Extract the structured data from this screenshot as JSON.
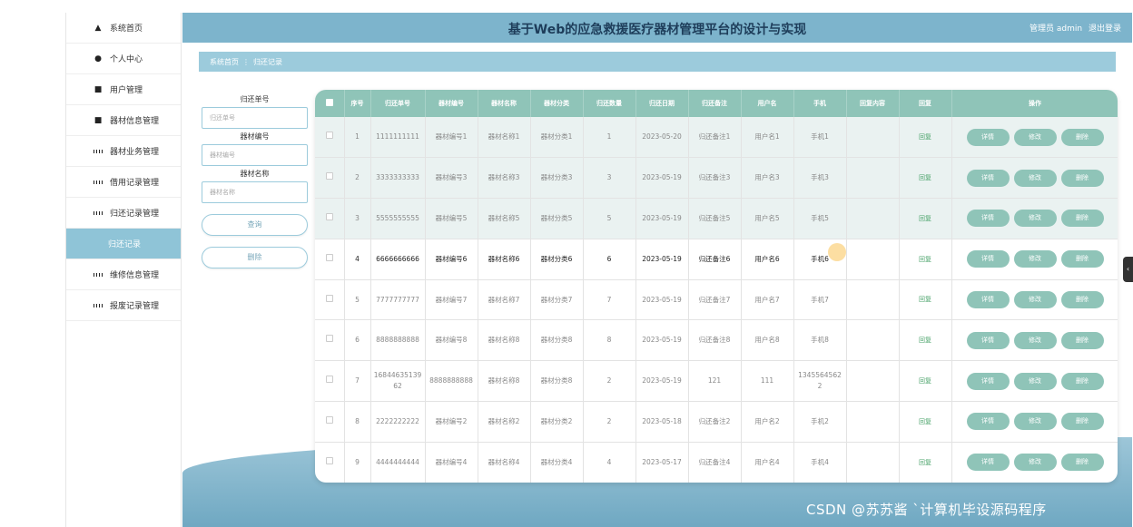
{
  "sidebar": {
    "items": [
      {
        "label": "系统首页",
        "icon": "home-icon"
      },
      {
        "label": "个人中心",
        "icon": "user-icon"
      },
      {
        "label": "用户管理",
        "icon": "clipboard-icon"
      },
      {
        "label": "器材信息管理",
        "icon": "box-icon"
      },
      {
        "label": "器材业务管理",
        "icon": "grid-icon"
      },
      {
        "label": "借用记录管理",
        "icon": "grid-icon"
      },
      {
        "label": "归还记录管理",
        "icon": "grid-icon"
      },
      {
        "label": "归还记录",
        "sub": true
      },
      {
        "label": "维修信息管理",
        "icon": "grid-icon"
      },
      {
        "label": "报废记录管理",
        "icon": "grid-icon"
      }
    ]
  },
  "header": {
    "title": "基于Web的应急救援医疗器材管理平台的设计与实现",
    "user": "管理员 admin",
    "logout": "退出登录"
  },
  "breadcrumb": {
    "home": "系统首页",
    "sep": "⋮",
    "current": "归还记录"
  },
  "search": {
    "f1_label": "归还单号",
    "f1_placeholder": "归还单号",
    "f2_label": "器材编号",
    "f2_placeholder": "器材编号",
    "f3_label": "器材名称",
    "f3_placeholder": "器材名称",
    "query": "查询",
    "delete": "删除"
  },
  "table": {
    "headers": [
      "序号",
      "归还单号",
      "器材编号",
      "器材名称",
      "器材分类",
      "归还数量",
      "归还日期",
      "归还备注",
      "用户名",
      "手机",
      "回复内容",
      "回复",
      "操作"
    ],
    "reply_label": "回复",
    "ops": {
      "detail": "详情",
      "edit": "修改",
      "delete": "删除"
    },
    "rows": [
      {
        "seq": "1",
        "no": "1111111111",
        "code": "器材编号1",
        "name": "器材名称1",
        "cat": "器材分类1",
        "qty": "1",
        "date": "2023-05-20",
        "note": "归还备注1",
        "user": "用户名1",
        "phone": "手机1",
        "content": ""
      },
      {
        "seq": "2",
        "no": "3333333333",
        "code": "器材编号3",
        "name": "器材名称3",
        "cat": "器材分类3",
        "qty": "3",
        "date": "2023-05-19",
        "note": "归还备注3",
        "user": "用户名3",
        "phone": "手机3",
        "content": ""
      },
      {
        "seq": "3",
        "no": "5555555555",
        "code": "器材编号5",
        "name": "器材名称5",
        "cat": "器材分类5",
        "qty": "5",
        "date": "2023-05-19",
        "note": "归还备注5",
        "user": "用户名5",
        "phone": "手机5",
        "content": ""
      },
      {
        "seq": "4",
        "no": "6666666666",
        "code": "器材编号6",
        "name": "器材名称6",
        "cat": "器材分类6",
        "qty": "6",
        "date": "2023-05-19",
        "note": "归还备注6",
        "user": "用户名6",
        "phone": "手机6",
        "content": ""
      },
      {
        "seq": "5",
        "no": "7777777777",
        "code": "器材编号7",
        "name": "器材名称7",
        "cat": "器材分类7",
        "qty": "7",
        "date": "2023-05-19",
        "note": "归还备注7",
        "user": "用户名7",
        "phone": "手机7",
        "content": ""
      },
      {
        "seq": "6",
        "no": "8888888888",
        "code": "器材编号8",
        "name": "器材名称8",
        "cat": "器材分类8",
        "qty": "8",
        "date": "2023-05-19",
        "note": "归还备注8",
        "user": "用户名8",
        "phone": "手机8",
        "content": ""
      },
      {
        "seq": "7",
        "no": "1684463513962",
        "code": "8888888888",
        "name": "器材名称8",
        "cat": "器材分类8",
        "qty": "2",
        "date": "2023-05-19",
        "note": "121",
        "user": "111",
        "phone": "13455645622",
        "content": ""
      },
      {
        "seq": "8",
        "no": "2222222222",
        "code": "器材编号2",
        "name": "器材名称2",
        "cat": "器材分类2",
        "qty": "2",
        "date": "2023-05-18",
        "note": "归还备注2",
        "user": "用户名2",
        "phone": "手机2",
        "content": ""
      },
      {
        "seq": "9",
        "no": "4444444444",
        "code": "器材编号4",
        "name": "器材名称4",
        "cat": "器材分类4",
        "qty": "4",
        "date": "2023-05-17",
        "note": "归还备注4",
        "user": "用户名4",
        "phone": "手机4",
        "content": ""
      }
    ]
  },
  "side_tab": "‹",
  "watermark": "CSDN @苏苏酱  `计算机毕设源码程序"
}
